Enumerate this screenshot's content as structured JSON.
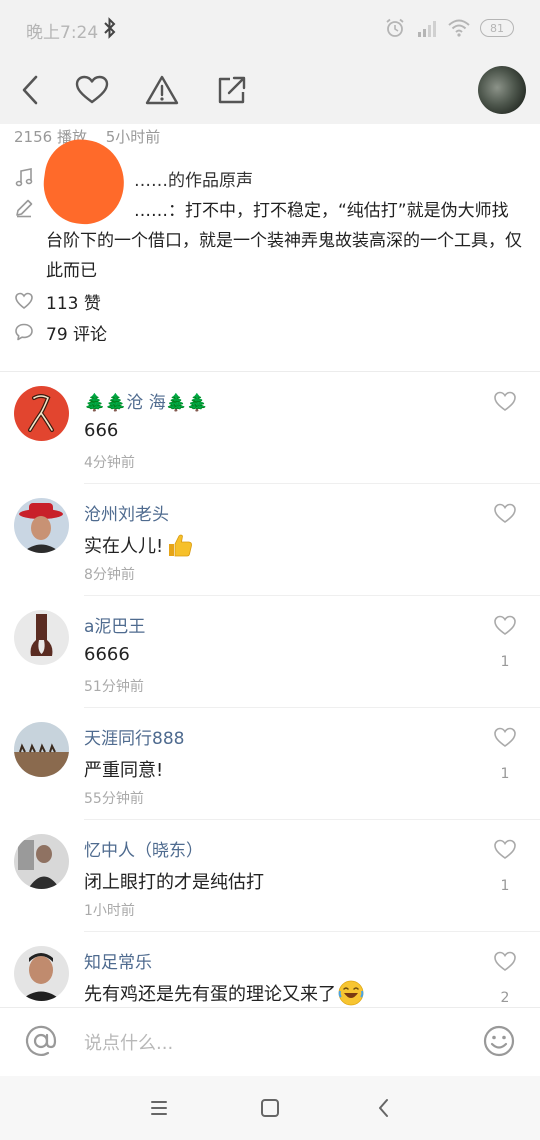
{
  "status_bar": {
    "time": "晚上7:24",
    "battery": "81",
    "icons": [
      "bluetooth-icon",
      "alarm-icon",
      "signal-icon",
      "wifi-icon",
      "battery-icon"
    ]
  },
  "toolbar": {
    "icons": [
      "back-icon",
      "heart-icon",
      "warning-icon",
      "share-icon",
      "avatar"
    ]
  },
  "post": {
    "plays": "2156 播放",
    "time_ago": "5小时前",
    "music": "……的作品原声",
    "description": "……：打不中，打不稳定，“纯估打”就是伪大师找台阶下的一个借口，就是一个装神弄鬼故装高深的一个工具，仅此而已",
    "likes": "113 赞",
    "comments": "79 评论"
  },
  "comments": [
    {
      "name": "🌲🌲沧 海🌲🌲",
      "text": "666",
      "time": "4分钟前",
      "likes": ""
    },
    {
      "name": "沧州刘老头",
      "text": "实在人儿!",
      "time": "8分钟前",
      "likes": "",
      "emoji": "thumbs-up-emoji"
    },
    {
      "name": "a泥巴王",
      "text": "6666",
      "time": "51分钟前",
      "likes": "1"
    },
    {
      "name": "天涯同行888",
      "text": "严重同意!",
      "time": "55分钟前",
      "likes": "1"
    },
    {
      "name": "忆中人（晓东）",
      "text": "闭上眼打的才是纯估打",
      "time": "1小时前",
      "likes": "1"
    },
    {
      "name": "知足常乐",
      "text": "先有鸡还是先有蛋的理论又来了",
      "time": "",
      "likes": "2",
      "emoji": "laughing-emoji"
    }
  ],
  "input_bar": {
    "placeholder": "说点什么..."
  },
  "colors": {
    "name_link": "#4f6b8f",
    "redaction": "#ff6a2a",
    "toolbar_bg": "#f2f2f2"
  }
}
